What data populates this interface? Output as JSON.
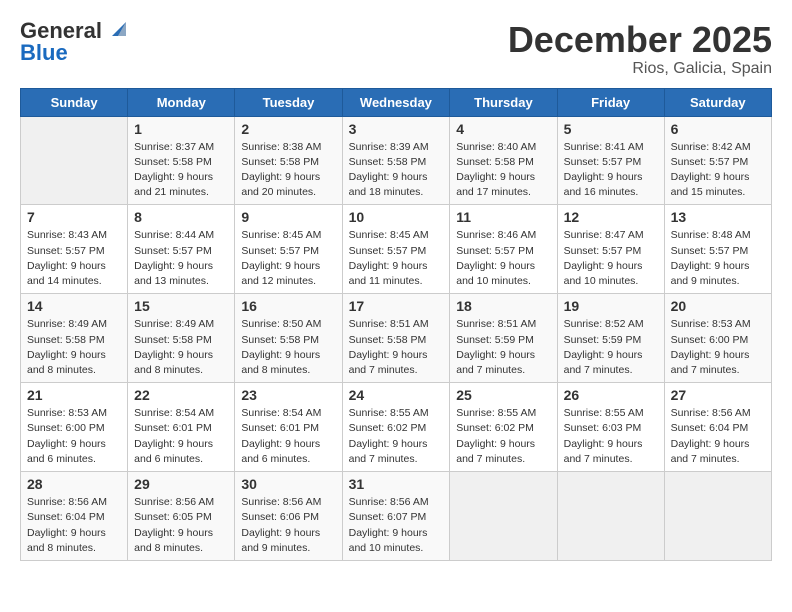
{
  "logo": {
    "general": "General",
    "blue": "Blue"
  },
  "title": "December 2025",
  "subtitle": "Rios, Galicia, Spain",
  "days_of_week": [
    "Sunday",
    "Monday",
    "Tuesday",
    "Wednesday",
    "Thursday",
    "Friday",
    "Saturday"
  ],
  "weeks": [
    [
      {
        "num": "",
        "info": ""
      },
      {
        "num": "1",
        "info": "Sunrise: 8:37 AM\nSunset: 5:58 PM\nDaylight: 9 hours\nand 21 minutes."
      },
      {
        "num": "2",
        "info": "Sunrise: 8:38 AM\nSunset: 5:58 PM\nDaylight: 9 hours\nand 20 minutes."
      },
      {
        "num": "3",
        "info": "Sunrise: 8:39 AM\nSunset: 5:58 PM\nDaylight: 9 hours\nand 18 minutes."
      },
      {
        "num": "4",
        "info": "Sunrise: 8:40 AM\nSunset: 5:58 PM\nDaylight: 9 hours\nand 17 minutes."
      },
      {
        "num": "5",
        "info": "Sunrise: 8:41 AM\nSunset: 5:57 PM\nDaylight: 9 hours\nand 16 minutes."
      },
      {
        "num": "6",
        "info": "Sunrise: 8:42 AM\nSunset: 5:57 PM\nDaylight: 9 hours\nand 15 minutes."
      }
    ],
    [
      {
        "num": "7",
        "info": "Sunrise: 8:43 AM\nSunset: 5:57 PM\nDaylight: 9 hours\nand 14 minutes."
      },
      {
        "num": "8",
        "info": "Sunrise: 8:44 AM\nSunset: 5:57 PM\nDaylight: 9 hours\nand 13 minutes."
      },
      {
        "num": "9",
        "info": "Sunrise: 8:45 AM\nSunset: 5:57 PM\nDaylight: 9 hours\nand 12 minutes."
      },
      {
        "num": "10",
        "info": "Sunrise: 8:45 AM\nSunset: 5:57 PM\nDaylight: 9 hours\nand 11 minutes."
      },
      {
        "num": "11",
        "info": "Sunrise: 8:46 AM\nSunset: 5:57 PM\nDaylight: 9 hours\nand 10 minutes."
      },
      {
        "num": "12",
        "info": "Sunrise: 8:47 AM\nSunset: 5:57 PM\nDaylight: 9 hours\nand 10 minutes."
      },
      {
        "num": "13",
        "info": "Sunrise: 8:48 AM\nSunset: 5:57 PM\nDaylight: 9 hours\nand 9 minutes."
      }
    ],
    [
      {
        "num": "14",
        "info": "Sunrise: 8:49 AM\nSunset: 5:58 PM\nDaylight: 9 hours\nand 8 minutes."
      },
      {
        "num": "15",
        "info": "Sunrise: 8:49 AM\nSunset: 5:58 PM\nDaylight: 9 hours\nand 8 minutes."
      },
      {
        "num": "16",
        "info": "Sunrise: 8:50 AM\nSunset: 5:58 PM\nDaylight: 9 hours\nand 8 minutes."
      },
      {
        "num": "17",
        "info": "Sunrise: 8:51 AM\nSunset: 5:58 PM\nDaylight: 9 hours\nand 7 minutes."
      },
      {
        "num": "18",
        "info": "Sunrise: 8:51 AM\nSunset: 5:59 PM\nDaylight: 9 hours\nand 7 minutes."
      },
      {
        "num": "19",
        "info": "Sunrise: 8:52 AM\nSunset: 5:59 PM\nDaylight: 9 hours\nand 7 minutes."
      },
      {
        "num": "20",
        "info": "Sunrise: 8:53 AM\nSunset: 6:00 PM\nDaylight: 9 hours\nand 7 minutes."
      }
    ],
    [
      {
        "num": "21",
        "info": "Sunrise: 8:53 AM\nSunset: 6:00 PM\nDaylight: 9 hours\nand 6 minutes."
      },
      {
        "num": "22",
        "info": "Sunrise: 8:54 AM\nSunset: 6:01 PM\nDaylight: 9 hours\nand 6 minutes."
      },
      {
        "num": "23",
        "info": "Sunrise: 8:54 AM\nSunset: 6:01 PM\nDaylight: 9 hours\nand 6 minutes."
      },
      {
        "num": "24",
        "info": "Sunrise: 8:55 AM\nSunset: 6:02 PM\nDaylight: 9 hours\nand 7 minutes."
      },
      {
        "num": "25",
        "info": "Sunrise: 8:55 AM\nSunset: 6:02 PM\nDaylight: 9 hours\nand 7 minutes."
      },
      {
        "num": "26",
        "info": "Sunrise: 8:55 AM\nSunset: 6:03 PM\nDaylight: 9 hours\nand 7 minutes."
      },
      {
        "num": "27",
        "info": "Sunrise: 8:56 AM\nSunset: 6:04 PM\nDaylight: 9 hours\nand 7 minutes."
      }
    ],
    [
      {
        "num": "28",
        "info": "Sunrise: 8:56 AM\nSunset: 6:04 PM\nDaylight: 9 hours\nand 8 minutes."
      },
      {
        "num": "29",
        "info": "Sunrise: 8:56 AM\nSunset: 6:05 PM\nDaylight: 9 hours\nand 8 minutes."
      },
      {
        "num": "30",
        "info": "Sunrise: 8:56 AM\nSunset: 6:06 PM\nDaylight: 9 hours\nand 9 minutes."
      },
      {
        "num": "31",
        "info": "Sunrise: 8:56 AM\nSunset: 6:07 PM\nDaylight: 9 hours\nand 10 minutes."
      },
      {
        "num": "",
        "info": ""
      },
      {
        "num": "",
        "info": ""
      },
      {
        "num": "",
        "info": ""
      }
    ]
  ]
}
